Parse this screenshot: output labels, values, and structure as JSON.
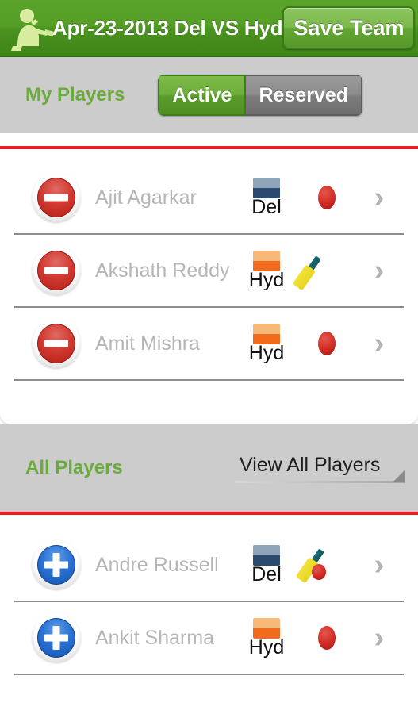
{
  "titlebar": {
    "icon": "batsman-icon",
    "title": "Apr-23-2013 Del VS Hyd",
    "save_label": "Save Team"
  },
  "my_players": {
    "section_label": "My Players",
    "toggle": {
      "options": [
        "Active",
        "Reserved"
      ],
      "selected": "Active",
      "active_label": "Active",
      "reserved_label": "Reserved"
    },
    "rows": [
      {
        "action": "remove",
        "action_icon": "minus-circle-icon",
        "name": "Ajit Agarkar",
        "team": "Del",
        "team_flag": "del-flag-icon",
        "role": "bowler",
        "role_icon": "cricket-ball-icon",
        "chevron": "›"
      },
      {
        "action": "remove",
        "action_icon": "minus-circle-icon",
        "name": "Akshath Reddy",
        "team": "Hyd",
        "team_flag": "hyd-flag-icon",
        "role": "batsman",
        "role_icon": "cricket-bat-icon",
        "chevron": "›"
      },
      {
        "action": "remove",
        "action_icon": "minus-circle-icon",
        "name": "Amit Mishra",
        "team": "Hyd",
        "team_flag": "hyd-flag-icon",
        "role": "bowler",
        "role_icon": "cricket-ball-icon",
        "chevron": "›"
      }
    ]
  },
  "all_players": {
    "section_label": "All Players",
    "filter_label": "View All Players",
    "rows": [
      {
        "action": "add",
        "action_icon": "plus-circle-icon",
        "name": "Andre Russell",
        "team": "Del",
        "team_flag": "del-flag-icon",
        "role": "all-rounder",
        "role_icon": "bat-and-ball-icon",
        "chevron": "›"
      },
      {
        "action": "add",
        "action_icon": "plus-circle-icon",
        "name": "Ankit Sharma",
        "team": "Hyd",
        "team_flag": "hyd-flag-icon",
        "role": "bowler",
        "role_icon": "cricket-ball-icon",
        "chevron": "›"
      }
    ]
  },
  "colors": {
    "titlebar_green": "#4b9320",
    "section_green_text": "#6aab3c",
    "divider_red": "#ee1c24",
    "header_gray": "#cccccc",
    "player_name_gray": "#b6b6b6",
    "remove_red": "#d23b32",
    "add_blue": "#2a72d4",
    "del_flag_top": "#8ea4b8",
    "del_flag_bottom": "#2b4a6f",
    "hyd_flag_top": "#f7b878",
    "hyd_flag_bottom": "#f26a1b",
    "bat_yellow": "#eedd2c",
    "ball_red": "#cf2a22"
  }
}
